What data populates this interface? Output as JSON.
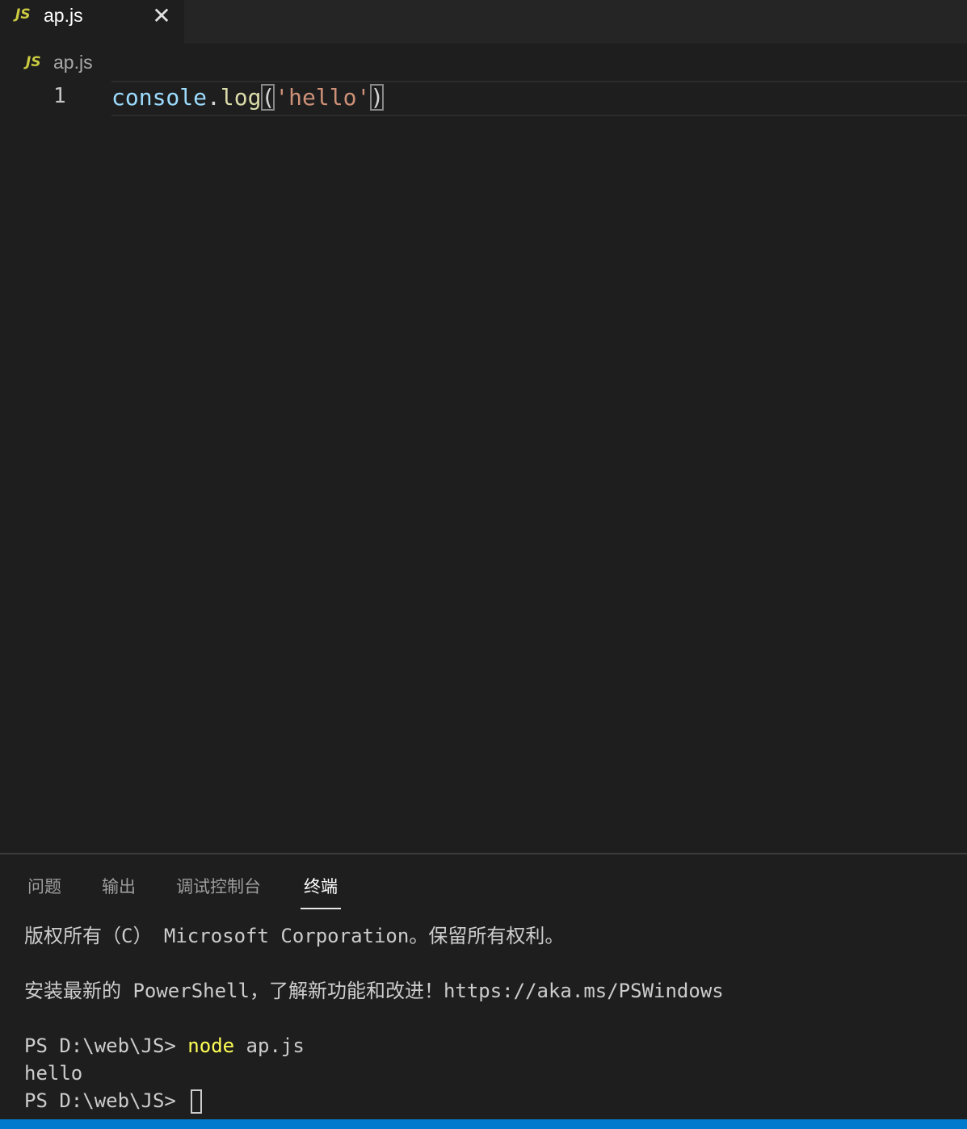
{
  "tab": {
    "badge": "JS",
    "label": "ap.js",
    "close_glyph": "✕"
  },
  "breadcrumb": {
    "badge": "JS",
    "label": "ap.js"
  },
  "editor": {
    "line_number": "1",
    "tokens": {
      "obj": "console",
      "dot": ".",
      "fn": "log",
      "open": "(",
      "str": "'hello'",
      "close": ")"
    }
  },
  "panel": {
    "tabs": [
      {
        "label": "问题"
      },
      {
        "label": "输出"
      },
      {
        "label": "调试控制台"
      },
      {
        "label": "终端",
        "active": true
      }
    ]
  },
  "terminal": {
    "line1": "版权所有（C） Microsoft Corporation。保留所有权利。",
    "line2": "安装最新的 PowerShell，了解新功能和改进！https://aka.ms/PSWindows",
    "line3_prompt": "PS D:\\web\\JS> ",
    "line3_cmd": "node",
    "line3_args": " ap.js",
    "line4": "hello",
    "line5_prompt": "PS D:\\web\\JS> "
  },
  "colors": {
    "accent_statusbar": "#007acc",
    "js_badge": "#cbcb41",
    "string": "#ce9178",
    "function": "#dcdcaa",
    "variable": "#9cdcfe"
  }
}
